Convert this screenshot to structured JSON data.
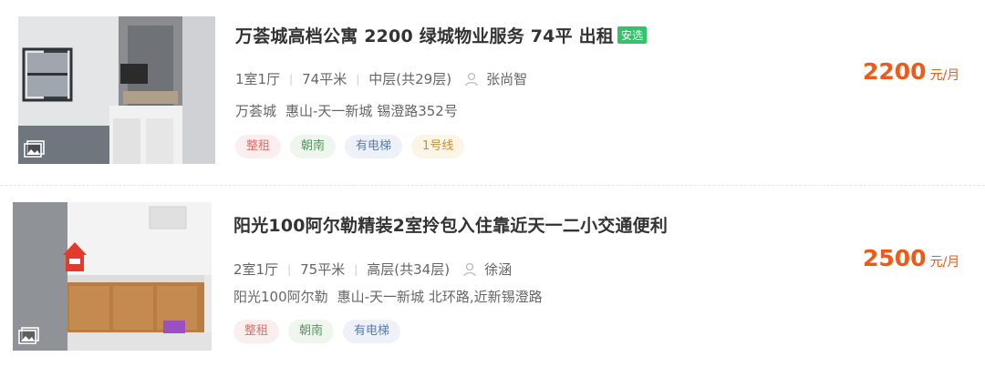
{
  "listings": [
    {
      "title": "万荟城高档公寓 2200 绿城物业服务 74平 出租",
      "badge": "安选",
      "layout": "1室1厅",
      "area": "74平米",
      "floor": "中层(共29层)",
      "agent": "张尚智",
      "community": "万荟城",
      "district": "惠山-天一新城 锡澄路352号",
      "tags": [
        "整租",
        "朝南",
        "有电梯",
        "1号线"
      ],
      "price": "2200",
      "price_unit": "元/月",
      "icons": {
        "gallery": "gallery-icon",
        "agent": "user-icon"
      }
    },
    {
      "title": "阳光100阿尔勒精装2室拎包入住靠近天一二小交通便利",
      "layout": "2室1厅",
      "area": "75平米",
      "floor": "高层(共34层)",
      "agent": "徐涵",
      "community": "阳光100阿尔勒",
      "district": "惠山-天一新城 北环路,近新锡澄路",
      "tags": [
        "整租",
        "朝南",
        "有电梯"
      ],
      "price": "2500",
      "price_unit": "元/月",
      "icons": {
        "gallery": "gallery-icon",
        "agent": "user-icon"
      }
    }
  ],
  "colors": {
    "price": "#f05a19",
    "badge": "#34c26a"
  }
}
